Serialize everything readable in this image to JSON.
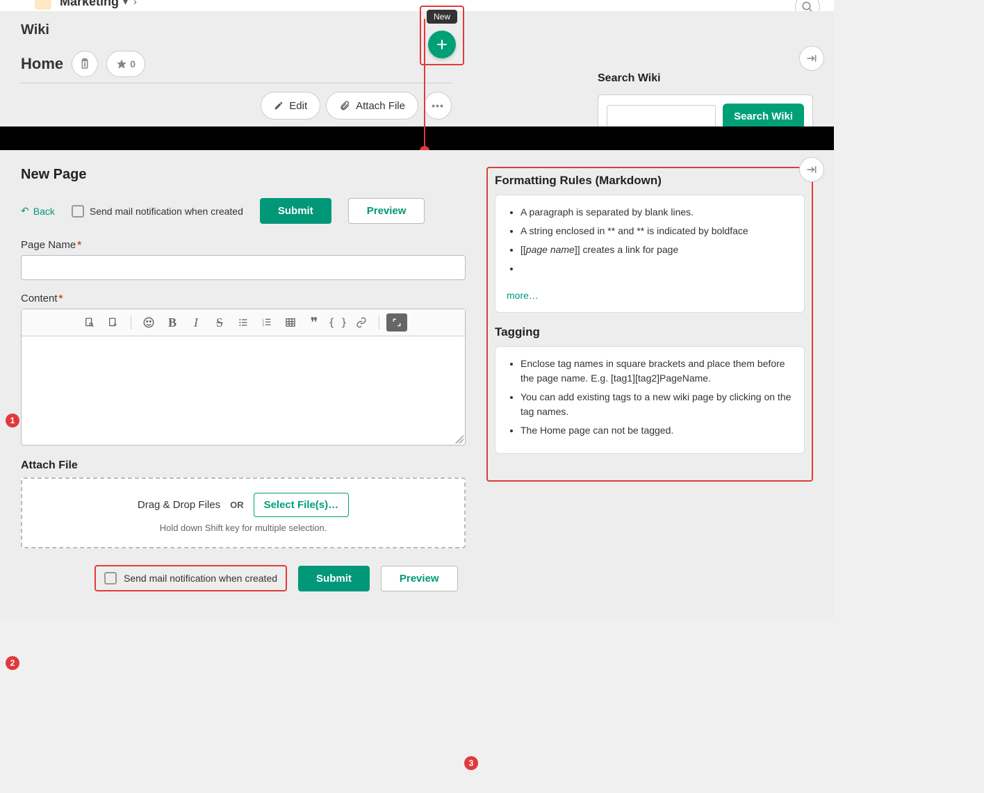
{
  "topbar": {
    "crumb": "Marketing"
  },
  "wiki": {
    "section_title": "Wiki",
    "page_title": "Home",
    "star_count": "0",
    "edit": "Edit",
    "attach": "Attach File"
  },
  "search": {
    "title": "Search Wiki",
    "button": "Search Wiki"
  },
  "new_button": {
    "tooltip": "New"
  },
  "newpage": {
    "title": "New Page",
    "back": "Back",
    "notify": "Send mail notification when created",
    "submit": "Submit",
    "preview": "Preview",
    "page_name_label": "Page Name",
    "content_label": "Content",
    "attach_label": "Attach File",
    "drag_drop": "Drag & Drop Files",
    "or": "OR",
    "select_files": "Select File(s)…",
    "shift_hint": "Hold down Shift key for multiple selection."
  },
  "formatting": {
    "title": "Formatting Rules (Markdown)",
    "rules": [
      "A paragraph is separated by blank lines.",
      "A string enclosed in ** and ** is indicated by boldface",
      "[[<i>page name</i>]] creates a link for page",
      ""
    ],
    "more": "more…"
  },
  "tagging": {
    "title": "Tagging",
    "rules": [
      "Enclose tag names in square brackets and place them before the page name. E.g. [tag1][tag2]PageName.",
      "You can add existing tags to a new wiki page by clicking on the tag names.",
      "The Home page can not be tagged."
    ]
  },
  "markers": {
    "one": "1",
    "two": "2",
    "three": "3"
  }
}
